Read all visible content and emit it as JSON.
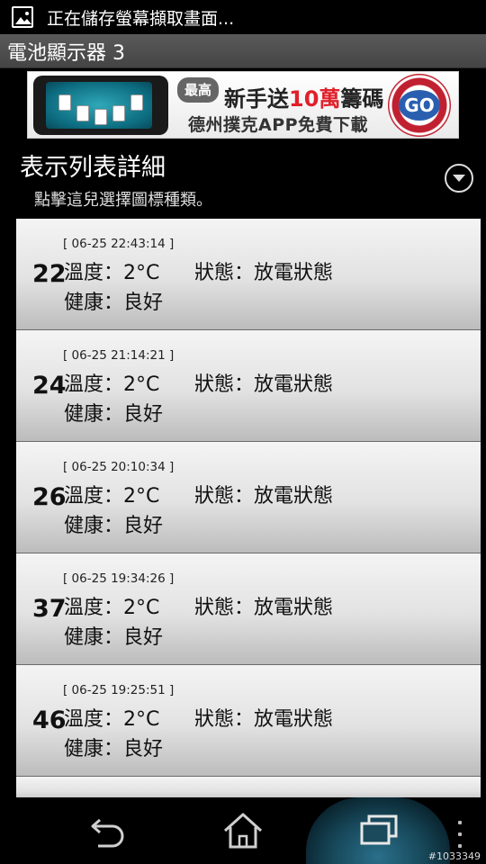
{
  "status_bar": {
    "text": "正在儲存螢幕擷取畫面...",
    "icon": "screenshot-icon"
  },
  "action_bar": {
    "title": "電池顯示器 3"
  },
  "ad": {
    "bubble": "最高",
    "line1_prefix": "新手送",
    "line1_highlight": "10萬",
    "line1_suffix": "籌碼",
    "line2": "德州撲克APP免費下載",
    "button": "GO"
  },
  "section": {
    "title": "表示列表詳細",
    "subtitle": "點擊這兒選擇圖標種類。",
    "dropdown_icon": "chevron-down-circle-icon"
  },
  "records": [
    {
      "timestamp": "[ 06-25 22:43:14 ]",
      "level": "22",
      "temp": "溫度：2°C",
      "state": "狀態：放電狀態",
      "health": "健康：良好"
    },
    {
      "timestamp": "[ 06-25 21:14:21 ]",
      "level": "24",
      "temp": "溫度：2°C",
      "state": "狀態：放電狀態",
      "health": "健康：良好"
    },
    {
      "timestamp": "[ 06-25 20:10:34 ]",
      "level": "26",
      "temp": "溫度：2°C",
      "state": "狀態：放電狀態",
      "health": "健康：良好"
    },
    {
      "timestamp": "[ 06-25 19:34:26 ]",
      "level": "37",
      "temp": "溫度：2°C",
      "state": "狀態：放電狀態",
      "health": "健康：良好"
    },
    {
      "timestamp": "[ 06-25 19:25:51 ]",
      "level": "46",
      "temp": "溫度：2°C",
      "state": "狀態：放電狀態",
      "health": "健康：良好"
    }
  ],
  "nav": {
    "back_icon": "back-icon",
    "home_icon": "home-icon",
    "recents_icon": "recent-apps-icon",
    "menu_icon": "more-vert-icon"
  },
  "watermark": "#1033349",
  "colors": {
    "background": "#000000",
    "row_top": "#f4f4f4",
    "row_bottom": "#bcbcbc",
    "ad_red": "#e0202a",
    "nav_glow": "#2a6f8a"
  }
}
